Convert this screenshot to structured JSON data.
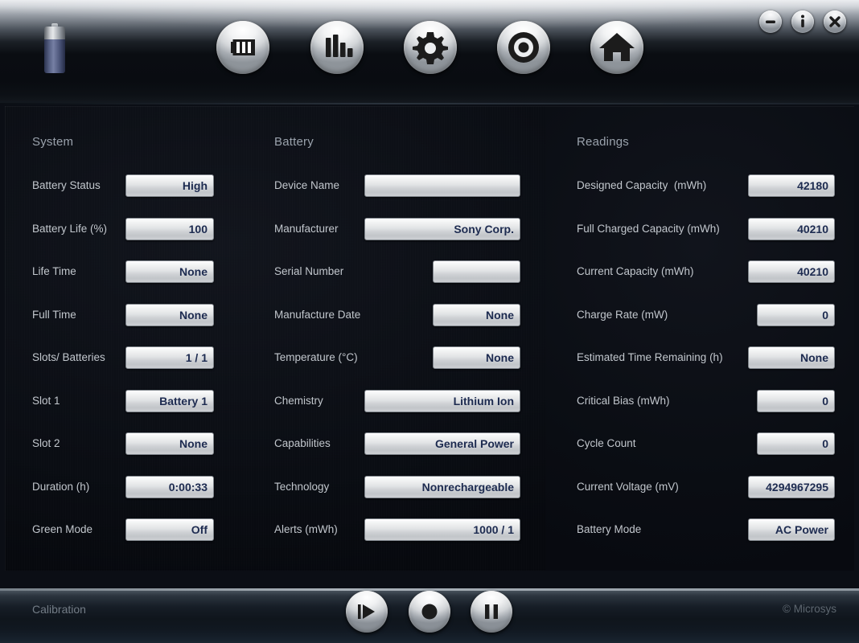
{
  "app": {
    "logo_icon": "battery-icon"
  },
  "header": {
    "nav": [
      {
        "name": "battery",
        "icon": "battery-icon"
      },
      {
        "name": "stats",
        "icon": "bar-chart-icon"
      },
      {
        "name": "settings",
        "icon": "gear-icon"
      },
      {
        "name": "target",
        "icon": "target-icon"
      },
      {
        "name": "home",
        "icon": "home-icon"
      }
    ],
    "window_controls": [
      {
        "name": "minimize",
        "icon": "minimize-icon"
      },
      {
        "name": "info",
        "icon": "info-icon"
      },
      {
        "name": "close",
        "icon": "close-icon"
      }
    ]
  },
  "columns": {
    "system": {
      "title": "System",
      "rows": [
        {
          "label": "Battery Status",
          "value": "High"
        },
        {
          "label": "Battery Life (%)",
          "value": "100"
        },
        {
          "label": "Life Time",
          "value": "None"
        },
        {
          "label": "Full Time",
          "value": "None"
        },
        {
          "label": "Slots/ Batteries",
          "value": "1 / 1"
        },
        {
          "label": "Slot 1",
          "value": "Battery 1"
        },
        {
          "label": "Slot 2",
          "value": "None"
        },
        {
          "label": "Duration (h)",
          "value": "0:00:33"
        },
        {
          "label": "Green Mode",
          "value": "Off"
        }
      ]
    },
    "battery": {
      "title": "Battery",
      "rows": [
        {
          "label": "Device Name",
          "value": ""
        },
        {
          "label": "Manufacturer",
          "value": "Sony Corp."
        },
        {
          "label": "Serial Number",
          "value": ""
        },
        {
          "label": "Manufacture Date",
          "value": "None"
        },
        {
          "label": "Temperature (°C)",
          "value": "None"
        },
        {
          "label": "Chemistry",
          "value": "Lithium Ion"
        },
        {
          "label": "Capabilities",
          "value": "General Power"
        },
        {
          "label": "Technology",
          "value": "Nonrechargeable"
        },
        {
          "label": "Alerts (mWh)",
          "value": "1000 / 1"
        }
      ]
    },
    "readings": {
      "title": "Readings",
      "rows": [
        {
          "label": "Designed Capacity  (mWh)",
          "value": "42180"
        },
        {
          "label": "Full Charged Capacity (mWh)",
          "value": "40210"
        },
        {
          "label": "Current Capacity (mWh)",
          "value": "40210"
        },
        {
          "label": "Charge Rate (mW)",
          "value": "0"
        },
        {
          "label": "Estimated Time Remaining (h)",
          "value": "None"
        },
        {
          "label": "Critical Bias (mWh)",
          "value": "0"
        },
        {
          "label": "Cycle Count",
          "value": "0"
        },
        {
          "label": "Current Voltage (mV)",
          "value": "4294967295"
        },
        {
          "label": "Battery Mode",
          "value": "AC Power"
        }
      ]
    }
  },
  "footer": {
    "calibration_label": "Calibration",
    "copyright": "© Microsys",
    "transport": [
      {
        "name": "play",
        "icon": "play-icon"
      },
      {
        "name": "record",
        "icon": "record-icon"
      },
      {
        "name": "pause",
        "icon": "pause-icon"
      }
    ]
  },
  "colors": {
    "header_top": "#e9ebee",
    "panel_bg": "#0b0e15",
    "field_bg": "#e2e4e6",
    "value_text": "#1d2b50",
    "label_text": "#c2c7cd",
    "title_text": "#9aa2ac",
    "footer_text": "#737c86"
  }
}
